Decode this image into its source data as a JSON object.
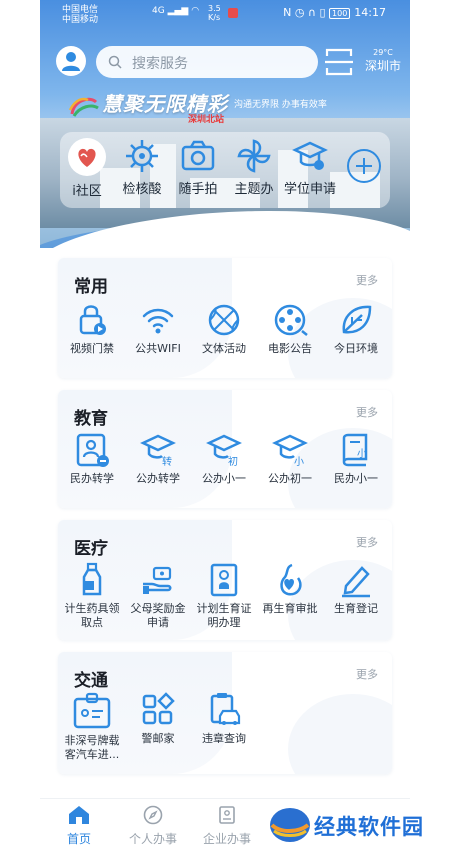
{
  "status_bar": {
    "carrier1": "中国电信",
    "carrier2": "中国移动",
    "network": "4G",
    "speed_value": "3.5",
    "speed_unit": "K/s",
    "battery": "100",
    "time": "14:17"
  },
  "header": {
    "search_placeholder": "搜索服务",
    "weather_temp": "29°C",
    "weather_city": "深圳市",
    "slogan": "慧聚无限精彩",
    "tagline": "沟通无界限 办事有效率",
    "tagline2": "深圳北站"
  },
  "quick_actions": [
    {
      "label": "i社区",
      "icon": "heart-community-icon"
    },
    {
      "label": "检核酸",
      "icon": "virus-icon"
    },
    {
      "label": "随手拍",
      "icon": "camera-icon"
    },
    {
      "label": "主题办",
      "icon": "pinwheel-icon"
    },
    {
      "label": "学位申请",
      "icon": "graduation-cap-icon"
    }
  ],
  "sections": [
    {
      "title": "常用",
      "more": "更多",
      "items": [
        {
          "label": "视频门禁",
          "icon": "video-door-lock-icon"
        },
        {
          "label": "公共WIFI",
          "icon": "wifi-icon"
        },
        {
          "label": "文体活动",
          "icon": "basketball-icon"
        },
        {
          "label": "电影公告",
          "icon": "film-reel-icon"
        },
        {
          "label": "今日环境",
          "icon": "leaf-icon"
        }
      ]
    },
    {
      "title": "教育",
      "more": "更多",
      "items": [
        {
          "label": "民办转学",
          "icon": "student-id-icon"
        },
        {
          "label": "公办转学",
          "icon": "cap-transfer-icon",
          "badge": "转"
        },
        {
          "label": "公办小一",
          "icon": "cap-primary-icon",
          "badge": "初"
        },
        {
          "label": "公办初一",
          "icon": "cap-junior-icon",
          "badge": "小"
        },
        {
          "label": "民办小一",
          "icon": "book-primary-icon",
          "badge": "小"
        }
      ]
    },
    {
      "title": "医疗",
      "more": "更多",
      "items": [
        {
          "label": "计生药具领取点",
          "icon": "bottle-icon"
        },
        {
          "label": "父母奖励金申请",
          "icon": "hand-money-icon"
        },
        {
          "label": "计划生育证明办理",
          "icon": "certificate-icon"
        },
        {
          "label": "再生育审批",
          "icon": "pregnancy-heart-icon"
        },
        {
          "label": "生育登记",
          "icon": "pen-register-icon"
        }
      ]
    },
    {
      "title": "交通",
      "more": "更多",
      "items": [
        {
          "label": "非深号牌载客汽车进...",
          "icon": "id-badge-icon"
        },
        {
          "label": "警邮家",
          "icon": "blocks-icon"
        },
        {
          "label": "违章查询",
          "icon": "car-clipboard-icon"
        }
      ]
    }
  ],
  "bottom_nav": [
    {
      "label": "首页",
      "icon": "home-icon",
      "active": true
    },
    {
      "label": "个人办事",
      "icon": "compass-icon",
      "active": false
    },
    {
      "label": "企业办事",
      "icon": "building-icon",
      "active": false
    }
  ],
  "watermark": "经典软件园",
  "colors": {
    "accent": "#2f86de",
    "icon_blue": "#2f8be0",
    "text": "#1b1f27"
  }
}
